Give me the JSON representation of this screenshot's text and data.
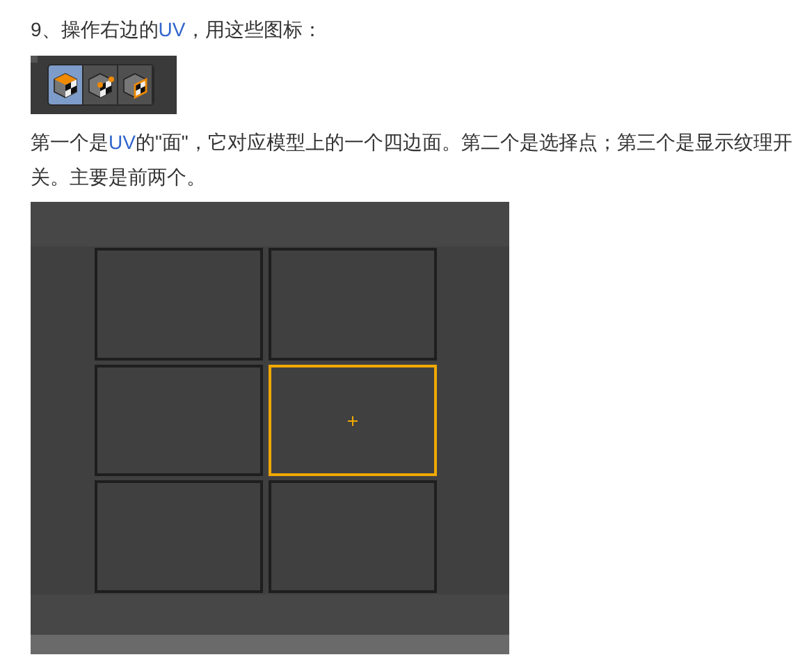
{
  "heading": [
    {
      "text": "9、操作右边的"
    },
    {
      "text": "UV",
      "kind": "link"
    },
    {
      "text": "，用这些图标："
    }
  ],
  "toolbar": {
    "buttons": [
      {
        "kind": "face",
        "selected": true
      },
      {
        "kind": "point",
        "selected": false
      },
      {
        "kind": "texture",
        "selected": false
      }
    ]
  },
  "paragraph": [
    {
      "text": "第一个是"
    },
    {
      "text": "UV",
      "kind": "link"
    },
    {
      "text": "的\"面\"，它对应模型上的一个四边面。第二个是选择点；第三个是显示纹理开关。主要是前两个。"
    }
  ],
  "uv_editor": {
    "faces": [
      {
        "selected": false
      },
      {
        "selected": false
      },
      {
        "selected": false
      },
      {
        "selected": true
      },
      {
        "selected": false
      },
      {
        "selected": false
      }
    ]
  }
}
